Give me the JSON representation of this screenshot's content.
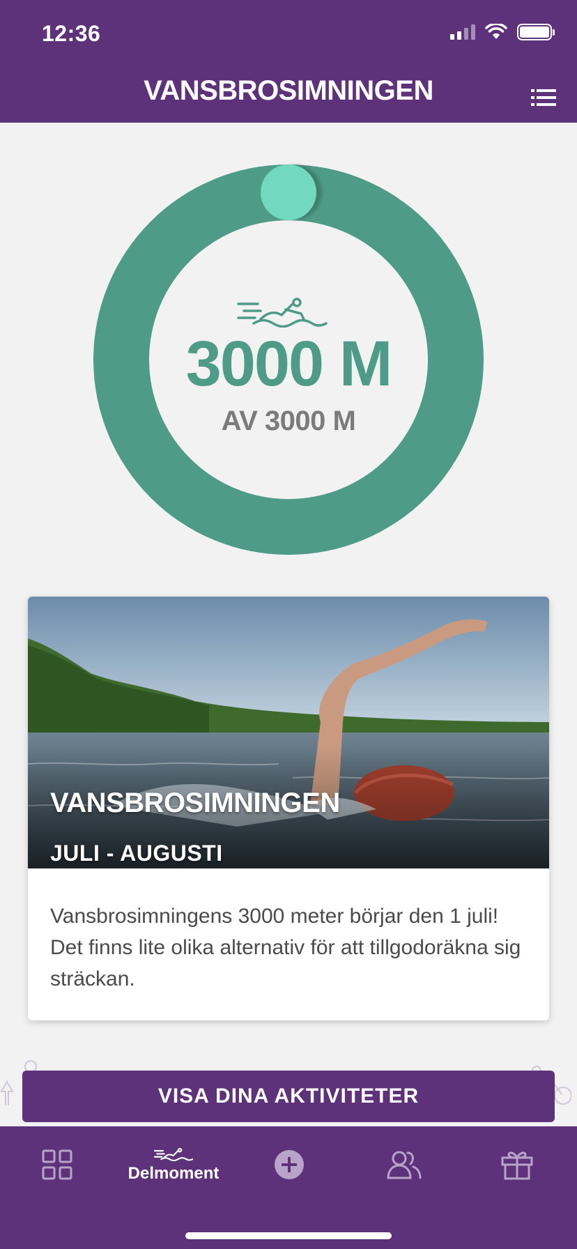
{
  "status_bar": {
    "time": "12:36"
  },
  "header": {
    "title": "VANSBROSIMNINGEN",
    "menu_icon": "list-icon"
  },
  "progress": {
    "value": "3000 M",
    "total": "AV 3000 M",
    "completed_fraction": 1.0,
    "icon": "swimmer-icon",
    "colors": {
      "ring": "#4e9b87",
      "knob": "#72d9c0"
    }
  },
  "event_card": {
    "title": "VANSBROSIMNINGEN",
    "subtitle": "JULI - AUGUSTI",
    "description": "Vansbrosimningens 3000 meter börjar den 1 juli! Det finns lite olika alternativ för att tillgodoräkna sig sträckan."
  },
  "actions": {
    "show_activities": "VISA DINA AKTIVITETER"
  },
  "tab_bar": {
    "items": [
      {
        "icon": "grid-icon",
        "label": ""
      },
      {
        "icon": "swimmer-icon",
        "label": "Delmoment"
      },
      {
        "icon": "add-circle-icon",
        "label": ""
      },
      {
        "icon": "people-icon",
        "label": ""
      },
      {
        "icon": "gift-icon",
        "label": ""
      }
    ]
  },
  "colors": {
    "brand": "#5e327a",
    "background": "#f2f2f2",
    "accent": "#4e9b87"
  }
}
